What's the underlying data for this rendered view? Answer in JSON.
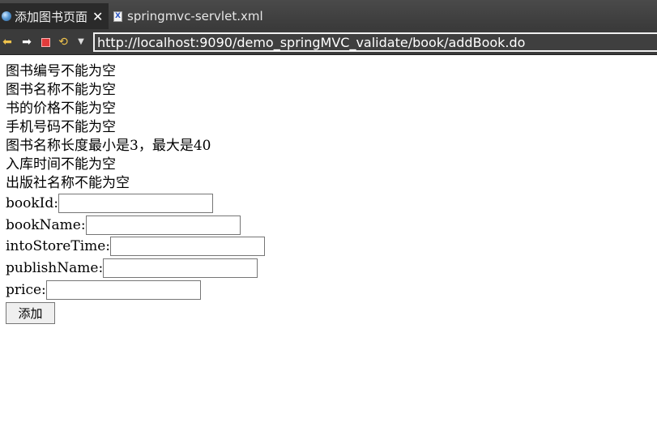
{
  "tabs": [
    {
      "label": "添加图书页面",
      "active": true,
      "close": "✕"
    },
    {
      "label": "springmvc-servlet.xml",
      "active": false
    }
  ],
  "toolbar": {
    "url": "http://localhost:9090/demo_springMVC_validate/book/addBook.do"
  },
  "errors": [
    "图书编号不能为空",
    "图书名称不能为空",
    "书的价格不能为空",
    "手机号码不能为空",
    "图书名称长度最小是3，最大是40",
    "入库时间不能为空",
    "出版社名称不能为空"
  ],
  "form": {
    "fields": [
      {
        "label": "bookId:",
        "value": ""
      },
      {
        "label": "bookName:",
        "value": ""
      },
      {
        "label": "intoStoreTime:",
        "value": ""
      },
      {
        "label": "publishName:",
        "value": ""
      },
      {
        "label": "price:",
        "value": ""
      }
    ],
    "submit_label": "添加"
  },
  "colors": {
    "tab_bar": "#3a3a3a",
    "url_bar_bg": "#3f3f3f",
    "page_bg": "#ffffff"
  }
}
